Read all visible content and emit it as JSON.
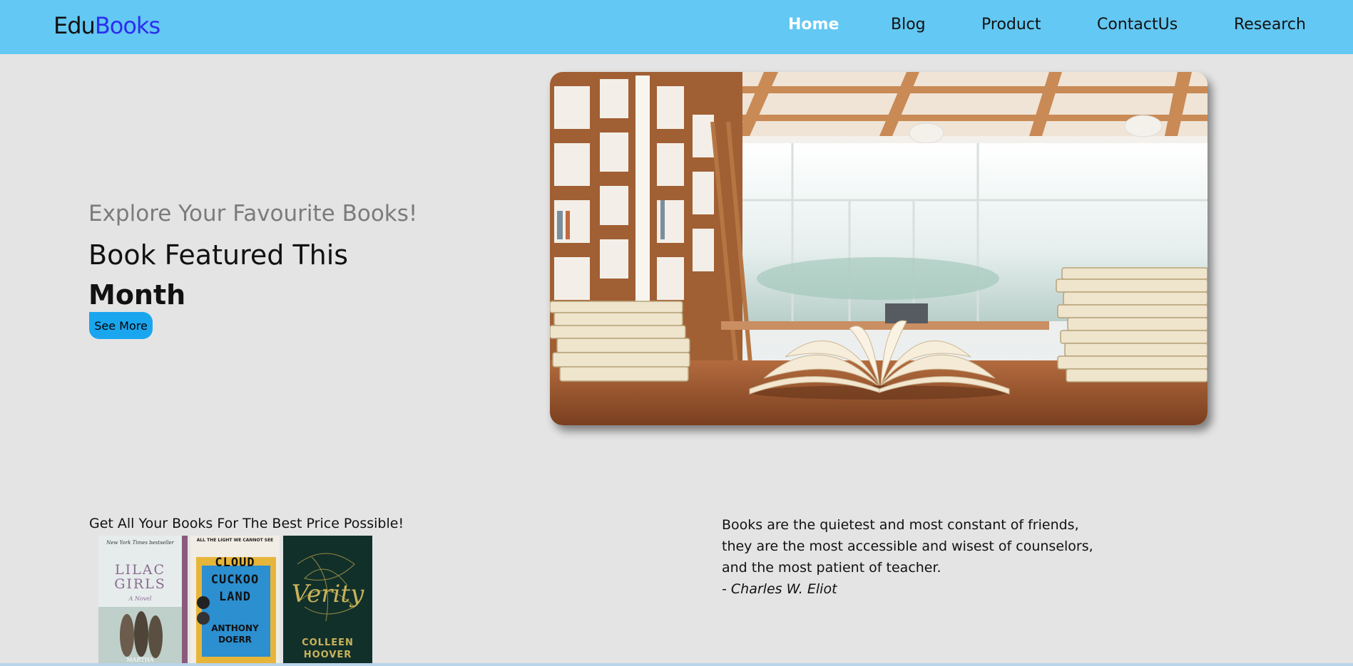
{
  "brand": {
    "part1": "Edu",
    "part2": "Books",
    "part2_color": "#2b2ef0"
  },
  "nav": {
    "items": [
      {
        "label": "Home",
        "active": true
      },
      {
        "label": "Blog",
        "active": false
      },
      {
        "label": "Product",
        "active": false
      },
      {
        "label": "ContactUs",
        "active": false
      },
      {
        "label": "Research",
        "active": false
      }
    ]
  },
  "hero": {
    "subtitle": "Explore Your Favourite Books!",
    "title_line1": "Book Featured This",
    "title_line2": "Month",
    "button_label": "See More"
  },
  "promo": {
    "text": "Get All Your Books For The Best Price Possible!",
    "books": [
      {
        "badge": "New York Times bestseller",
        "title_l1": "LILAC",
        "title_l2": "GIRLS",
        "sub": "A Novel",
        "author": "MARTHA"
      },
      {
        "badge": "ALL THE LIGHT WE CANNOT SEE",
        "title_l1": "CLOUD",
        "title_l2": "CUCKOO",
        "title_l3": "LAND",
        "author1": "ANTHONY",
        "author2": "DOERR"
      },
      {
        "title": "Verity",
        "author1": "COLLEEN",
        "author2": "HOOVER"
      }
    ]
  },
  "quote": {
    "line1": "Books are the quietest and most constant of friends,",
    "line2": "they are the most accessible and wisest of counselors,",
    "line3": "and the most patient of teacher.",
    "author": "- Charles W. Eliot"
  },
  "colors": {
    "header_bg": "#63c8f3",
    "page_bg": "#e4e4e4",
    "button_bg": "#1aa6ee"
  }
}
